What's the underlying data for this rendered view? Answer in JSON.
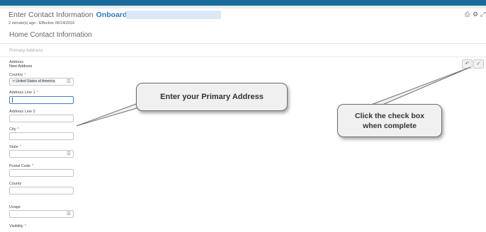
{
  "header": {
    "title": "Enter Contact Information",
    "title_accent": "Onboarding for",
    "meta": "2 minute(s) ago - Effective 06/14/2016",
    "icons": [
      "print-icon",
      "gear-icon",
      "expand-icon"
    ]
  },
  "section": {
    "title": "Home Contact Information",
    "subtitle": "Primary Address"
  },
  "address": {
    "label": "Address",
    "value": "New Address"
  },
  "fields": {
    "country": {
      "label": "Country",
      "value": "United States of America",
      "required": true
    },
    "address1": {
      "label": "Address Line 1",
      "value": "",
      "required": true
    },
    "address2": {
      "label": "Address Line 2",
      "value": "",
      "required": false
    },
    "city": {
      "label": "City",
      "value": "",
      "required": true
    },
    "state": {
      "label": "State",
      "value": "",
      "required": true
    },
    "postal": {
      "label": "Postal Code",
      "value": "",
      "required": true
    },
    "county": {
      "label": "County",
      "value": "",
      "required": false
    },
    "usage": {
      "label": "Usage",
      "value": "",
      "required": false
    },
    "visibility": {
      "label": "Visibility",
      "value": "",
      "required": true
    }
  },
  "required_marker": "*",
  "actions": {
    "cancel_icon": "undo-icon",
    "submit_icon": "checkmark-icon"
  },
  "callouts": {
    "primary_address": "Enter your Primary Address",
    "check_line1": "Click the check box",
    "check_line2": "when complete"
  },
  "colors": {
    "topbar": "#1b6a9c",
    "accent": "#2f7dbf",
    "required": "#d9534f",
    "callout_bg": "#f0f0f0"
  }
}
